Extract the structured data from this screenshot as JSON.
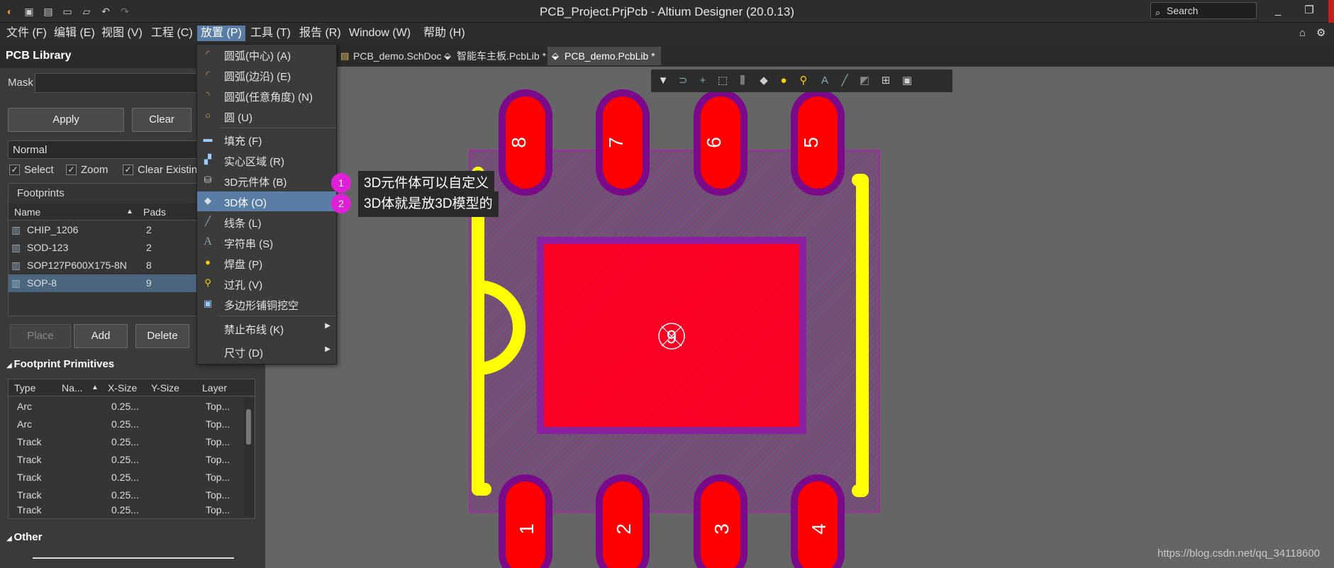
{
  "window": {
    "title": "PCB_Project.PrjPcb - Altium Designer (20.0.13)",
    "search_placeholder": "Search",
    "quick_access_icons": [
      "app-logo-icon",
      "save-icon",
      "save-all-icon",
      "open-folder-icon",
      "open-icon",
      "undo-icon",
      "redo-icon"
    ]
  },
  "menubar": {
    "items": [
      "文件 (F)",
      "编辑 (E)",
      "视图 (V)",
      "工程 (C)",
      "放置 (P)",
      "工具 (T)",
      "报告 (R)",
      "Window (W)",
      "帮助 (H)"
    ]
  },
  "panel": {
    "title": "PCB Library",
    "mask_label": "Mask",
    "mask_value": "",
    "apply": "Apply",
    "clear": "Clear",
    "mode": "Normal",
    "checks": [
      {
        "label": "Select",
        "checked": true
      },
      {
        "label": "Zoom",
        "checked": true
      },
      {
        "label": "Clear Existing",
        "checked": true
      }
    ],
    "footprints_title": "Footprints",
    "footprints_cols": [
      "Name",
      "Pads"
    ],
    "footprints": [
      {
        "name": "CHIP_1206",
        "pads": "2"
      },
      {
        "name": "SOD-123",
        "pads": "2"
      },
      {
        "name": "SOP127P600X175-8N",
        "pads": "8"
      },
      {
        "name": "SOP-8",
        "pads": "9"
      }
    ],
    "place": "Place",
    "add": "Add",
    "delete": "Delete",
    "primitives_title": "Footprint Primitives",
    "primitives_cols": [
      "Type",
      "Na...",
      "X-Size",
      "Y-Size",
      "Layer"
    ],
    "primitives": [
      {
        "type": "Arc",
        "x": "0.25...",
        "layer": "Top..."
      },
      {
        "type": "Arc",
        "x": "0.25...",
        "layer": "Top..."
      },
      {
        "type": "Track",
        "x": "0.25...",
        "layer": "Top..."
      },
      {
        "type": "Track",
        "x": "0.25...",
        "layer": "Top..."
      },
      {
        "type": "Track",
        "x": "0.25...",
        "layer": "Top..."
      },
      {
        "type": "Track",
        "x": "0.25...",
        "layer": "Top..."
      },
      {
        "type": "Track",
        "x": "0.25...",
        "layer": "Top..."
      }
    ],
    "other_title": "Other"
  },
  "doc_tabs": [
    {
      "label": "PCB_demo.SchDoc",
      "active": false
    },
    {
      "label": "智能车主板.PcbLib *",
      "active": false
    },
    {
      "label": "PCB_demo.PcbLib *",
      "active": true
    }
  ],
  "place_menu": {
    "items": [
      {
        "label": "圆弧(中心) (A)",
        "icon": "arc-center-icon"
      },
      {
        "label": "圆弧(边沿) (E)",
        "icon": "arc-edge-icon"
      },
      {
        "label": "圆弧(任意角度) (N)",
        "icon": "arc-any-angle-icon"
      },
      {
        "label": "圆 (U)",
        "icon": "circle-icon"
      },
      {
        "label": "填充 (F)",
        "icon": "fill-icon"
      },
      {
        "label": "实心区域 (R)",
        "icon": "solid-region-icon"
      },
      {
        "label": "3D元件体 (B)",
        "icon": "3d-component-body-icon"
      },
      {
        "label": "3D体 (O)",
        "icon": "3d-body-icon"
      },
      {
        "label": "线条 (L)",
        "icon": "line-icon"
      },
      {
        "label": "字符串 (S)",
        "icon": "string-icon"
      },
      {
        "label": "焊盘 (P)",
        "icon": "pad-icon"
      },
      {
        "label": "过孔 (V)",
        "icon": "via-icon"
      },
      {
        "label": "多边形铺铜挖空",
        "icon": "polygon-cutout-icon"
      },
      {
        "label": "禁止布线 (K)",
        "icon": ""
      },
      {
        "label": "尺寸 (D)",
        "icon": ""
      }
    ]
  },
  "callouts": [
    {
      "num": "1",
      "text": "3D元件体可以自定义"
    },
    {
      "num": "2",
      "text": "3D体就是放3D模型的"
    }
  ],
  "canvas": {
    "top_pads": [
      "8",
      "7",
      "6",
      "5"
    ],
    "bottom_pads": [
      "1",
      "2",
      "3",
      "4"
    ],
    "center_pad": "9",
    "colors": {
      "pad": "#ff0000",
      "pad_outline": "#7a0a8a",
      "silk": "#ffff00",
      "courtyard": "#b000b0",
      "background": "#656565"
    }
  },
  "watermark": "https://blog.csdn.net/qq_34118600"
}
